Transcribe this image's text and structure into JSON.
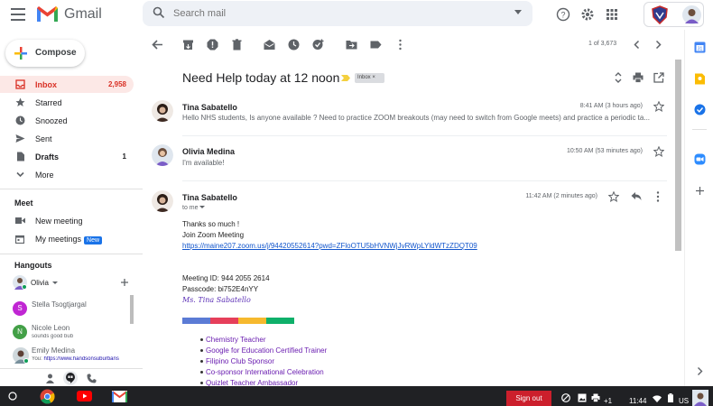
{
  "header": {
    "app_name": "Gmail",
    "search_placeholder": "Search mail"
  },
  "sidebar": {
    "compose_label": "Compose",
    "items": [
      {
        "label": "Inbox",
        "count": "2,958"
      },
      {
        "label": "Starred",
        "count": ""
      },
      {
        "label": "Snoozed",
        "count": ""
      },
      {
        "label": "Sent",
        "count": ""
      },
      {
        "label": "Drafts",
        "count": "1"
      },
      {
        "label": "More",
        "count": ""
      }
    ],
    "meet": {
      "title": "Meet",
      "new_meeting": "New meeting",
      "my_meetings": "My meetings",
      "new_badge": "New"
    },
    "hangouts": {
      "title": "Hangouts",
      "current_user": "Olivia",
      "contacts": [
        {
          "name": "Stella Tsogtjargal",
          "initial": "S",
          "color": "#c026d3",
          "status": ""
        },
        {
          "name": "Nicole Leon",
          "initial": "N",
          "color": "#43a047",
          "status": "sounds good bub"
        },
        {
          "name": "Emily Medina",
          "initial": "",
          "color": "#9aa0a6",
          "status_prefix": "You: ",
          "status": "https://www.handsonsuburbans"
        }
      ]
    }
  },
  "toolbar": {
    "pager": "1 of 3,673"
  },
  "thread": {
    "subject": "Need Help today at 12 noon",
    "label": "Inbox ×",
    "messages": [
      {
        "sender": "Tina Sabatello",
        "time": "8:41 AM (3 hours ago)",
        "snippet": "Hello NHS students, Is anyone available ? Need to practice ZOOM breakouts (may need to switch from Google meets) and practice a periodic ta..."
      },
      {
        "sender": "Olivia Medina",
        "time": "10:50 AM (53 minutes ago)",
        "snippet": "I'm available!"
      },
      {
        "sender": "Tina Sabatello",
        "time": "11:42 AM (2 minutes ago)",
        "to": "to me",
        "body": {
          "line1": "Thanks so much !",
          "line2": " Join Zoom Meeting",
          "link": "https://maine207.zoom.us/j/94420552614?pwd=ZFloOTU5bHVNWjJvRWpLYldWTzZDQT09",
          "meeting_id": "Meeting ID: 944 2055 2614",
          "passcode": "Passcode: bi752E4nYY",
          "signature": "Ms. Tina Sabatello",
          "bullets": [
            "Chemistry Teacher",
            "Google for Education Certified Trainer",
            "Filipino Club Sponsor",
            "Co-sponsor International Celebration",
            "Quizlet Teacher Ambassador"
          ]
        }
      }
    ]
  },
  "taskbar": {
    "signout": "Sign out",
    "notif_count": "+1",
    "time": "11:44",
    "locale": "US"
  },
  "colors": {
    "accent_red": "#d93025",
    "strip": [
      "#4285f4",
      "#ea4335",
      "#fbbc04",
      "#34a853"
    ]
  }
}
